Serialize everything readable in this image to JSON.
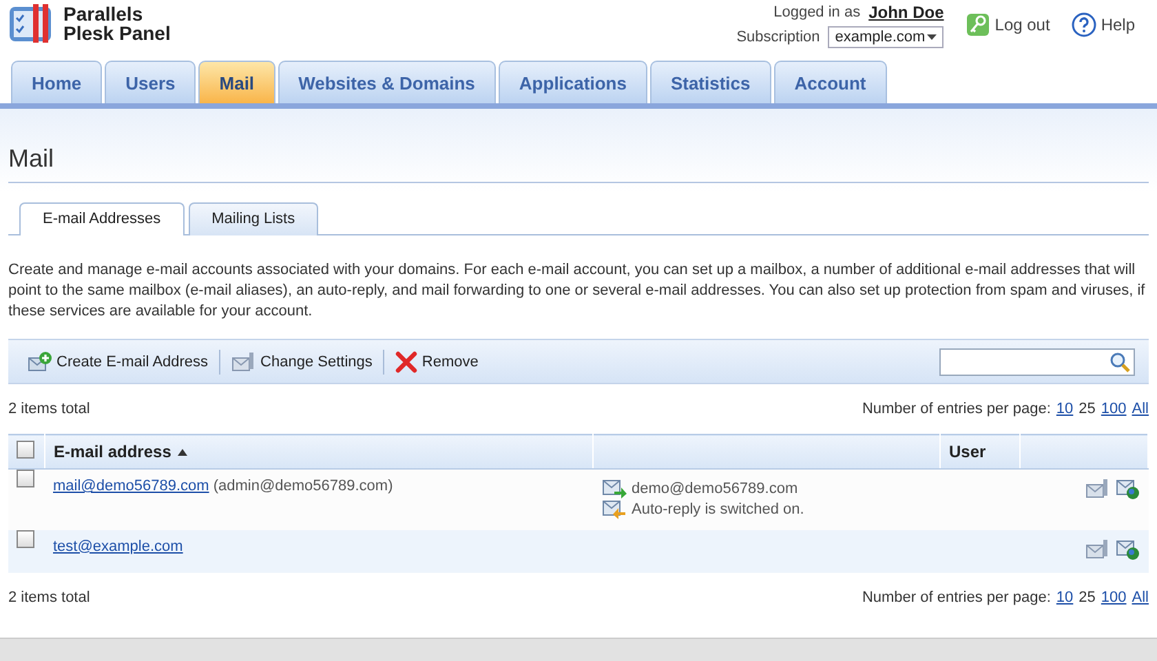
{
  "logo": {
    "line_1": "Parallels",
    "line_2": "Plesk Panel"
  },
  "user": {
    "logged_label": "Logged in as",
    "name": "John Doe",
    "subscription_label": "Subscription",
    "subscription": "example.com"
  },
  "top_links": [
    {
      "kind": "logout",
      "label": "Log out"
    },
    {
      "kind": "help",
      "label": "Help"
    }
  ],
  "tabs": [
    {
      "label": "Home",
      "selected": false
    },
    {
      "label": "Users",
      "selected": false
    },
    {
      "label": "Mail",
      "selected": true
    },
    {
      "label": "Websites & Domains",
      "selected": false
    },
    {
      "label": "Applications",
      "selected": false
    },
    {
      "label": "Statistics",
      "selected": false
    },
    {
      "label": "Account",
      "selected": false
    }
  ],
  "page_title": "Mail",
  "subtabs": [
    {
      "label": "E-mail Addresses",
      "selected": true
    },
    {
      "label": "Mailing Lists",
      "selected": false
    }
  ],
  "description": "Create and manage e-mail accounts associated with your domains. For each e-mail account, you can set up a mailbox, a number of additional e-mail addresses that will point to the same mailbox (e-mail aliases), an auto-reply, and mail forwarding to one or several e-mail addresses. You can also set up protection from spam and viruses, if these services are available for your account.",
  "toolbar": [
    {
      "kind": "create",
      "label": "Create E-mail Address"
    },
    {
      "kind": "settings",
      "label": "Change Settings"
    },
    {
      "kind": "remove",
      "label": "Remove"
    }
  ],
  "items_total": "2 items total",
  "per_page": {
    "label": "Number of entries per page:",
    "options": [
      {
        "label": "10",
        "selected": false
      },
      {
        "label": "25",
        "selected": true
      },
      {
        "label": "100",
        "selected": false
      },
      {
        "label": "All",
        "selected": false
      }
    ]
  },
  "table": {
    "select_all_checked": false,
    "columns": [
      {
        "label": "E-mail address",
        "sorted": true
      },
      {},
      {
        "label": "User"
      }
    ],
    "rows": [
      {
        "checked": false,
        "address": "mail@demo56789.com",
        "extra": "(admin@demo56789.com)",
        "notes": [
          {
            "kind": "forward",
            "text": "demo@demo56789.com"
          },
          {
            "kind": "autoreply",
            "text": "Auto-reply is switched on."
          }
        ]
      },
      {
        "checked": false,
        "address": "test@example.com",
        "notes": []
      }
    ]
  },
  "footer_items_total": "2 items total",
  "footer_per_page": {
    "label": "Number of entries per page:",
    "options": [
      {
        "label": "10",
        "selected": false
      },
      {
        "label": "25",
        "selected": true
      },
      {
        "label": "100",
        "selected": false
      },
      {
        "label": "All",
        "selected": false
      }
    ]
  }
}
